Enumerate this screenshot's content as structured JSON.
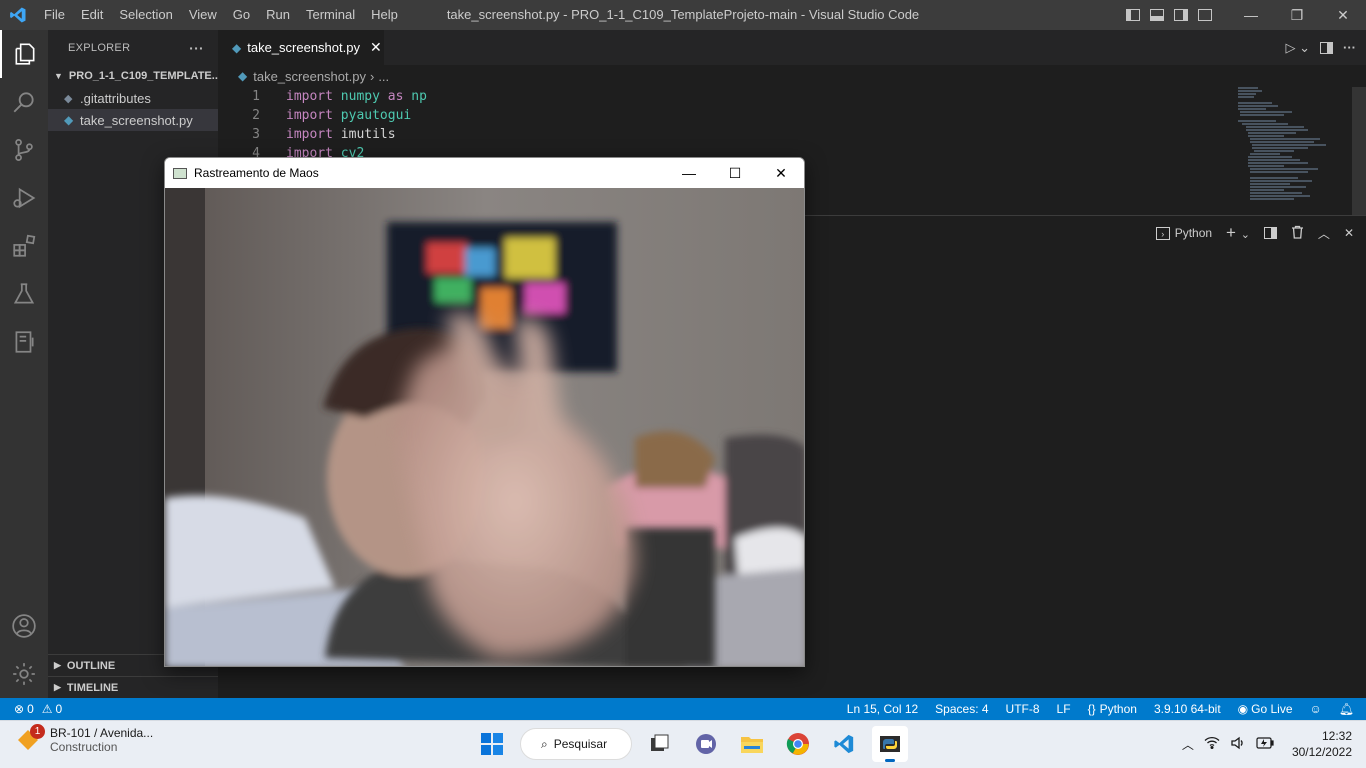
{
  "titlebar": {
    "menu": [
      "File",
      "Edit",
      "Selection",
      "View",
      "Go",
      "Run",
      "Terminal",
      "Help"
    ],
    "title": "take_screenshot.py - PRO_1-1_C109_TemplateProjeto-main - Visual Studio Code",
    "window_controls": {
      "minimize": "—",
      "restore": "❐",
      "close": "✕"
    }
  },
  "sidebar": {
    "header": "EXPLORER",
    "more": "···",
    "folder": "PRO_1-1_C109_TEMPLATE...",
    "files": [
      {
        "name": ".gitattributes",
        "icon": "gear-file-icon"
      },
      {
        "name": "take_screenshot.py",
        "icon": "python-icon",
        "active": true
      }
    ],
    "outline": "OUTLINE",
    "timeline": "TIMELINE"
  },
  "editor": {
    "tab_label": "take_screenshot.py",
    "breadcrumb_file": "take_screenshot.py",
    "breadcrumb_more": "...",
    "lines": [
      {
        "n": "1",
        "kw": "import",
        "mod": "numpy",
        "rest": " as ",
        "alias": "np"
      },
      {
        "n": "2",
        "kw": "import",
        "mod": "pyautogui",
        "rest": "",
        "alias": ""
      },
      {
        "n": "3",
        "kw": "import",
        "mod": "imutils",
        "rest": "",
        "alias": ""
      },
      {
        "n": "4",
        "kw": "import",
        "mod": "cv2",
        "rest": "",
        "alias": ""
      }
    ]
  },
  "panel": {
    "terminal_label": "Python"
  },
  "camera_window": {
    "title": "Rastreamento de Maos",
    "controls": {
      "minimize": "—",
      "maximize": "☐",
      "close": "✕"
    }
  },
  "statusbar": {
    "errors": "0",
    "warnings": "0",
    "position": "Ln 15, Col 12",
    "spaces": "Spaces: 4",
    "encoding": "UTF-8",
    "eol": "LF",
    "language": "Python",
    "interpreter": "3.9.10 64-bit",
    "golive": "Go Live"
  },
  "taskbar": {
    "weather_badge": "1",
    "weather_title": "BR-101 / Avenida...",
    "weather_subtitle": "Construction",
    "search_label": "Pesquisar",
    "time": "12:32",
    "date": "30/12/2022"
  },
  "colors": {
    "accent": "#007acc",
    "keyword": "#c586c0",
    "module": "#4ec9b0",
    "python_icon": "#519aba"
  }
}
